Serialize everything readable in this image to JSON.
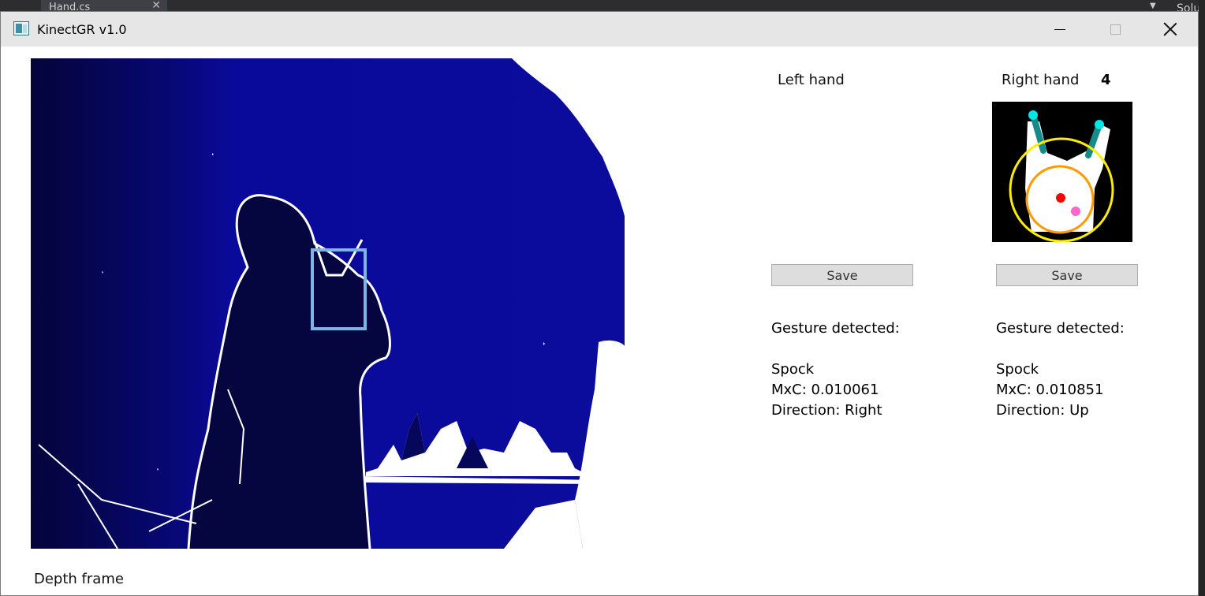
{
  "ide": {
    "tab_label": "Hand.cs",
    "right_panel_label": "Solu"
  },
  "window": {
    "title": "KinectGR v1.0",
    "minimize_label": "",
    "maximize_label": "",
    "close_label": ""
  },
  "depth_frame": {
    "label": "Depth frame",
    "background_color": "#0a0a9a",
    "highlight_box_color": "#7fb4e8"
  },
  "left_hand": {
    "label": "Left hand",
    "save_label": "Save",
    "gesture_header": "Gesture detected:",
    "gesture_name": "Spock",
    "mxc": "MxC: 0.010061",
    "direction": "Direction: Right"
  },
  "right_hand": {
    "label": "Right hand",
    "finger_count": "4",
    "save_label": "Save",
    "gesture_header": "Gesture detected:",
    "gesture_name": "Spock",
    "mxc": "MxC: 0.010851",
    "direction": "Direction: Up"
  }
}
